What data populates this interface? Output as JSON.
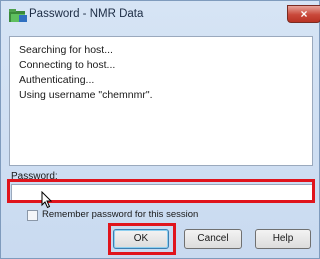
{
  "window": {
    "title": "Password - NMR Data",
    "close_glyph": "×",
    "icon": "app-folder-icon"
  },
  "log": {
    "lines": [
      "Searching for host...",
      "Connecting to host...",
      "Authenticating...",
      "Using username \"chemnmr\"."
    ]
  },
  "password": {
    "label": "Password:",
    "value": "",
    "placeholder": ""
  },
  "remember": {
    "label": "Remember password for this session",
    "checked": false
  },
  "buttons": {
    "ok": "OK",
    "cancel": "Cancel",
    "help": "Help"
  },
  "colors": {
    "highlight": "#e0141c",
    "window_bg": "#d6e4f5",
    "close_button": "#c9483a"
  }
}
